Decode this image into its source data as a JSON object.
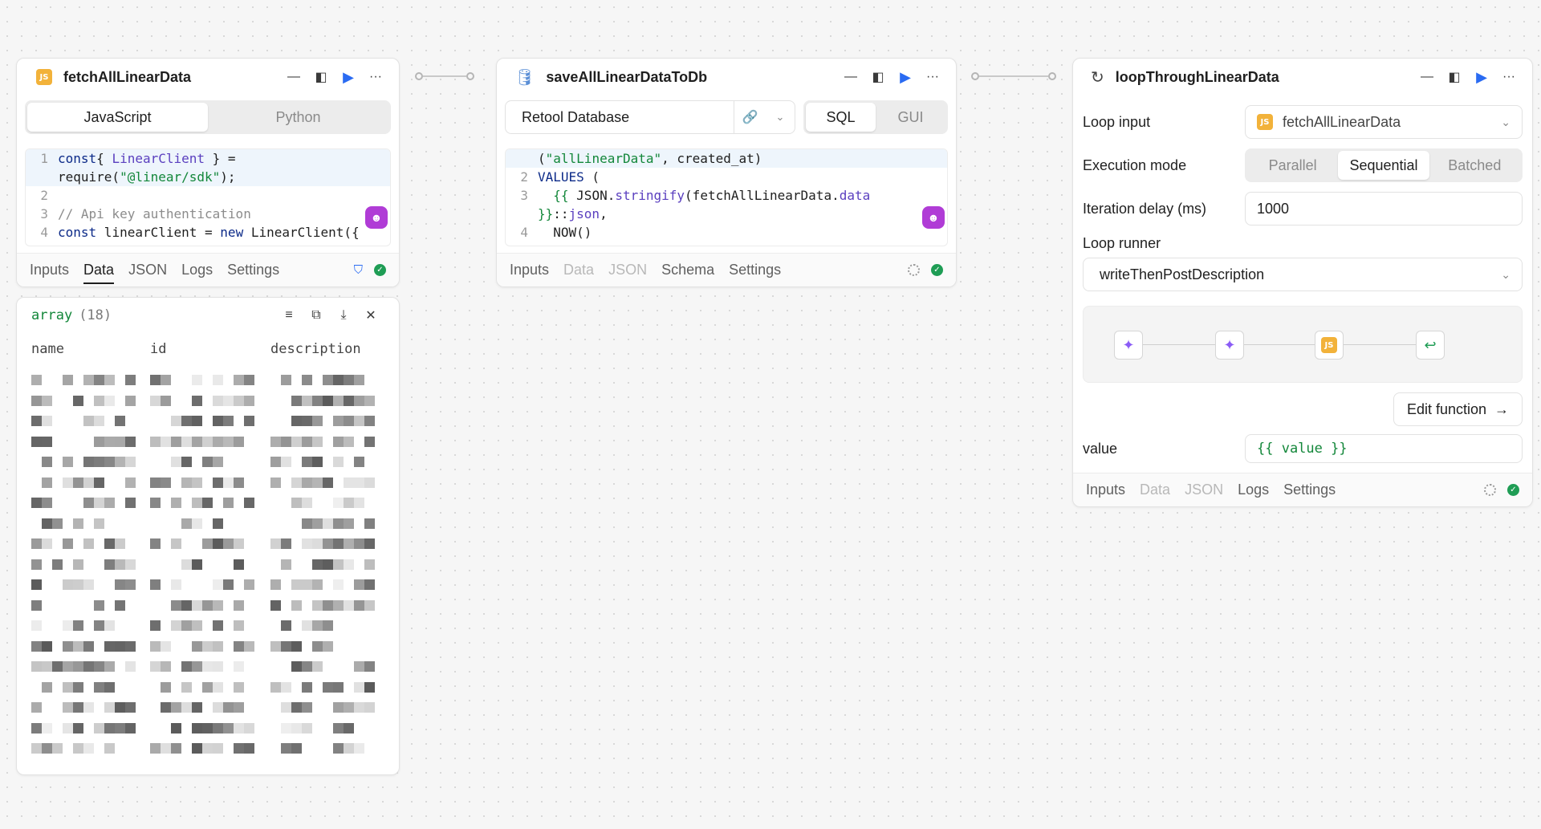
{
  "blocks": {
    "fetch": {
      "title": "fetchAllLinearData",
      "badge": "JS",
      "lang_tabs": [
        "JavaScript",
        "Python"
      ],
      "selected_lang": "JavaScript",
      "code": [
        {
          "n": "1",
          "parts": [
            [
              "kw",
              "const"
            ],
            [
              "",
              "{ "
            ],
            [
              "fn",
              "LinearClient"
            ],
            [
              "",
              " } ="
            ]
          ]
        },
        {
          "n": "",
          "parts": [
            [
              "",
              "require("
            ],
            [
              "str",
              "\"@linear/sdk\""
            ],
            [
              "",
              ");"
            ]
          ]
        },
        {
          "n": "2",
          "parts": [
            [
              "",
              ""
            ]
          ]
        },
        {
          "n": "3",
          "parts": [
            [
              "cm",
              "// Api key authentication"
            ]
          ]
        },
        {
          "n": "4",
          "parts": [
            [
              "kw",
              "const"
            ],
            [
              "",
              " linearClient = "
            ],
            [
              "kw",
              "new"
            ],
            [
              "",
              " LinearClient({"
            ]
          ]
        }
      ],
      "footer_tabs": [
        "Inputs",
        "Data",
        "JSON",
        "Logs",
        "Settings"
      ],
      "active_tab": "Data"
    },
    "save": {
      "title": "saveAllLinearDataToDb",
      "resource": "Retool Database",
      "mode_tabs": [
        "SQL",
        "GUI"
      ],
      "selected_mode": "SQL",
      "code": [
        {
          "n": "",
          "parts": [
            [
              "",
              "("
            ],
            [
              "str",
              "\"allLinearData\""
            ],
            [
              "",
              ", created_at)"
            ]
          ]
        },
        {
          "n": "2",
          "parts": [
            [
              "kw",
              "VALUES"
            ],
            [
              "",
              " ("
            ]
          ]
        },
        {
          "n": "3",
          "parts": [
            [
              "",
              "  "
            ],
            [
              "str",
              "{{ "
            ],
            [
              "",
              "JSON."
            ],
            [
              "fn",
              "stringify"
            ],
            [
              "",
              "(fetchAllLinearData."
            ],
            [
              "fn",
              "data"
            ],
            [
              ")"
            ]
          ]
        },
        {
          "n": "",
          "parts": [
            [
              "str",
              "}}"
            ],
            [
              "",
              "::"
            ],
            [
              "fn",
              "json"
            ],
            [
              "",
              ","
            ]
          ]
        },
        {
          "n": "4",
          "parts": [
            [
              "",
              "  NOW()"
            ]
          ]
        }
      ],
      "footer_tabs": [
        "Inputs",
        "Data",
        "JSON",
        "Schema",
        "Settings"
      ]
    },
    "loop": {
      "title": "loopThroughLinearData",
      "loop_input_label": "Loop input",
      "loop_input_value": "fetchAllLinearData",
      "exec_label": "Execution mode",
      "exec_options": [
        "Parallel",
        "Sequential",
        "Batched"
      ],
      "exec_selected": "Sequential",
      "delay_label": "Iteration delay (ms)",
      "delay_value": "1000",
      "runner_label": "Loop runner",
      "runner_value": "writeThenPostDescription",
      "edit_function": "Edit function",
      "value_label": "value",
      "value_value": "{{ value }}",
      "footer_tabs": [
        "Inputs",
        "Data",
        "JSON",
        "Logs",
        "Settings"
      ]
    }
  },
  "data_panel": {
    "title": "array",
    "count": "(18)",
    "columns": [
      "name",
      "id",
      "description"
    ]
  },
  "colors": {
    "accent": "#2a6bf2",
    "success": "#1f9d55",
    "js_badge": "#f2b23a",
    "ai": "#b03cd6"
  }
}
